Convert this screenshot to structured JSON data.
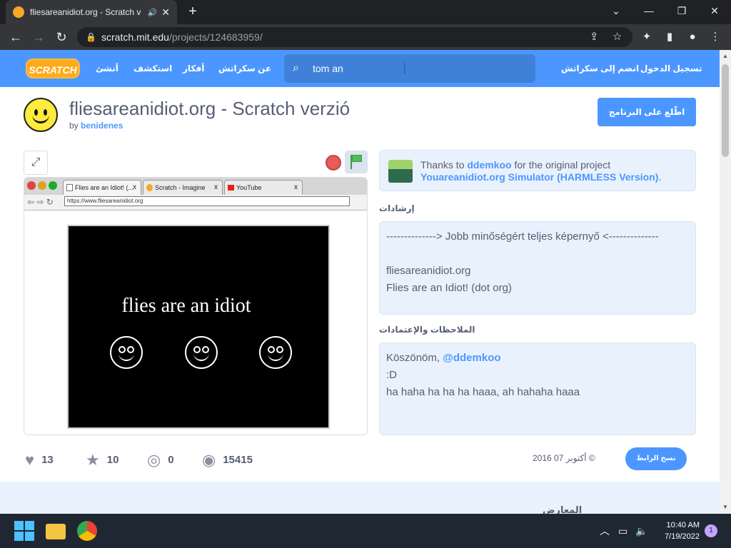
{
  "browser": {
    "tab_title": "fliesareanidiot.org - Scratch v",
    "tab_audio": "🔊",
    "tab_close": "✕",
    "new_tab": "+",
    "win_min": "⌄",
    "win_minimize": "—",
    "win_restore": "❐",
    "win_close": "✕",
    "url_host": "scratch.mit.edu",
    "url_path": "/projects/124683959/"
  },
  "scratch_nav": {
    "logo": "SCRATCH",
    "create": "أنشئ",
    "explore": "استكشف",
    "ideas": "أفكار",
    "about": "عن سكراتش",
    "search_value": "tom an",
    "join": "انضم إلى سكراتش",
    "sign_in": "تسجيل الدخول"
  },
  "project": {
    "title": "fliesareanidiot.org - Scratch verzió",
    "by_label": "by",
    "author": "benidenes",
    "see_inside": "اطّلع على البرنامج"
  },
  "stage": {
    "tabs": [
      "Flies are an Idiot! (...",
      "Scratch - Imagine",
      "YouTube"
    ],
    "tab_close": "x",
    "url": "https://www.fliesareanidiot.org",
    "text": "flies are an idiot"
  },
  "credit": {
    "thanks_prefix": "Thanks to",
    "thanks_user": "ddemkoo",
    "thanks_suffix": "for the original project",
    "original_title": "Youareanidiot.org Simulator (HARMLESS Version)",
    "original_suffix": "."
  },
  "instructions": {
    "label": "إرشادات",
    "line1": "--------------> Jobb minőségért teljes képernyő <--------------",
    "line2": "fliesareanidiot.org",
    "line3": "Flies are an Idiot! (dot org)"
  },
  "notes": {
    "label": "الملاحظات والإعتمادات",
    "line1_prefix": "Köszönöm,",
    "line1_mention": "@ddemkoo",
    "line2": ":D",
    "line3": "ha haha ha ha ha haaa, ah hahaha haaa"
  },
  "stats": {
    "loves": "13",
    "favorites": "10",
    "remixes": "0",
    "views": "15415",
    "date": "أكتوبر 07 2016 ©",
    "copy_link": "نسخ الرابط"
  },
  "lower": {
    "studios": "المعارض"
  },
  "taskbar": {
    "time": "10:40 AM",
    "date": "7/19/2022",
    "notifications": "1"
  }
}
